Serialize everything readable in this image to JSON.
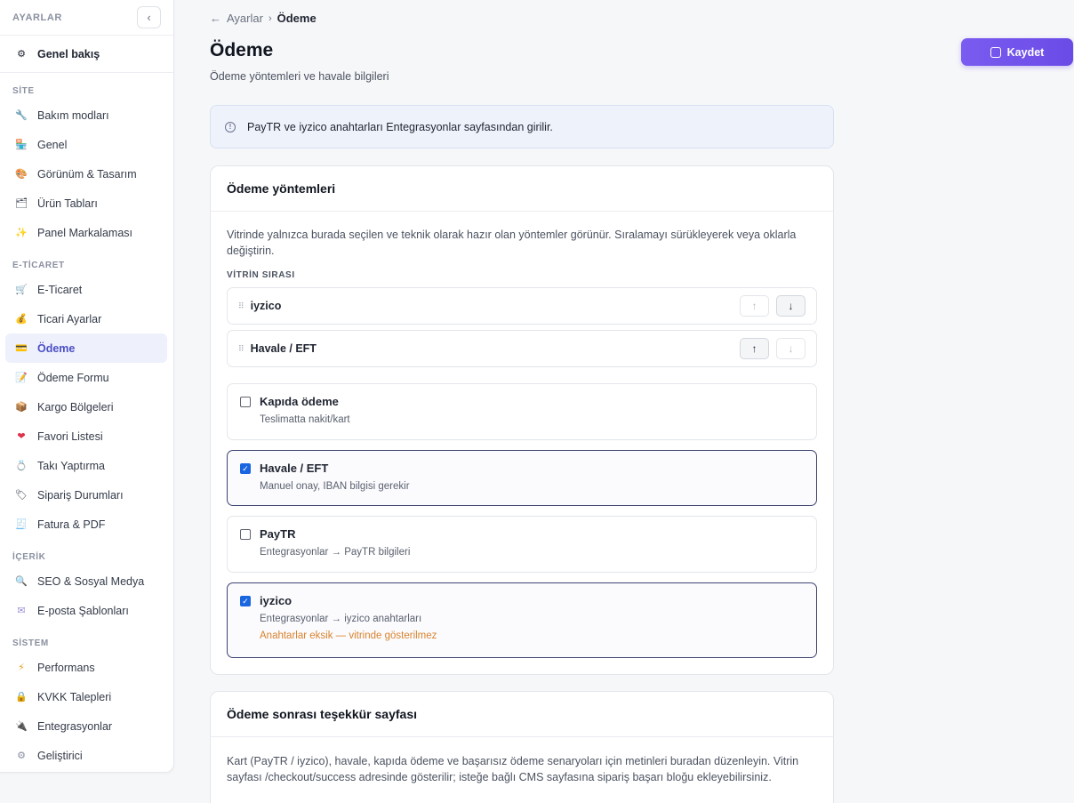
{
  "sidebar": {
    "title": "AYARLAR",
    "collapse_icon": "‹",
    "top_item": {
      "label": "Genel bakış",
      "icon": "⚙"
    },
    "sections": [
      {
        "label": "SİTE",
        "items": [
          {
            "label": "Bakım modları",
            "icon": "🔧"
          },
          {
            "label": "Genel",
            "icon": "🏪"
          },
          {
            "label": "Görünüm & Tasarım",
            "icon": "🎨"
          },
          {
            "label": "Ürün Tabları",
            "icon": "🗂"
          },
          {
            "label": "Panel Markalaması",
            "icon": "✨"
          }
        ]
      },
      {
        "label": "E-TİCARET",
        "items": [
          {
            "label": "E-Ticaret",
            "icon": "🛒"
          },
          {
            "label": "Ticari Ayarlar",
            "icon": "💰"
          },
          {
            "label": "Ödeme",
            "icon": "💳"
          },
          {
            "label": "Ödeme Formu",
            "icon": "📝"
          },
          {
            "label": "Kargo Bölgeleri",
            "icon": "📦"
          },
          {
            "label": "Favori Listesi",
            "icon": "❤"
          },
          {
            "label": "Takı Yaptırma",
            "icon": "💍"
          },
          {
            "label": "Sipariş Durumları",
            "icon": "🏷"
          },
          {
            "label": "Fatura & PDF",
            "icon": "🧾"
          }
        ]
      },
      {
        "label": "İÇERİK",
        "items": [
          {
            "label": "SEO & Sosyal Medya",
            "icon": "🔍"
          },
          {
            "label": "E-posta Şablonları",
            "icon": "✉"
          }
        ]
      },
      {
        "label": "SİSTEM",
        "items": [
          {
            "label": "Performans",
            "icon": "⚡"
          },
          {
            "label": "KVKK Talepleri",
            "icon": "🔒"
          },
          {
            "label": "Entegrasyonlar",
            "icon": "🔌"
          },
          {
            "label": "Geliştirici",
            "icon": "⚙"
          }
        ]
      }
    ]
  },
  "breadcrumb": {
    "back_arrow": "←",
    "parent": "Ayarlar",
    "separator": "›",
    "current": "Ödeme"
  },
  "page": {
    "title": "Ödeme",
    "subtitle": "Ödeme yöntemleri ve havale bilgileri"
  },
  "save_button": {
    "label": "Kaydet"
  },
  "info_banner": {
    "icon": "!",
    "text": "PayTR ve iyzico anahtarları Entegrasyonlar sayfasından girilir."
  },
  "payment_methods_card": {
    "title": "Ödeme yöntemleri",
    "description": "Vitrinde yalnızca burada seçilen ve teknik olarak hazır olan yöntemler görünür. Sıralamayı sürükleyerek veya oklarla değiştirin.",
    "order_label": "VİTRİN SIRASI",
    "order": [
      {
        "name": "iyzico",
        "up_enabled": false,
        "down_enabled": true
      },
      {
        "name": "Havale / EFT",
        "up_enabled": true,
        "down_enabled": false
      }
    ],
    "arrow_up": "↑",
    "arrow_down": "↓",
    "drag_handle": "⠿",
    "methods": [
      {
        "name": "Kapıda ödeme",
        "desc": "Teslimatta nakit/kart",
        "checked": false,
        "warning": ""
      },
      {
        "name": "Havale / EFT",
        "desc": "Manuel onay, IBAN bilgisi gerekir",
        "checked": true,
        "warning": ""
      },
      {
        "name": "PayTR",
        "desc": "Entegrasyonlar → PayTR bilgileri",
        "checked": false,
        "warning": ""
      },
      {
        "name": "iyzico",
        "desc": "Entegrasyonlar → iyzico anahtarları",
        "checked": true,
        "warning": "Anahtarlar eksik — vitrinde gösterilmez"
      }
    ],
    "check_mark": "✓"
  },
  "thanks_card": {
    "title": "Ödeme sonrası teşekkür sayfası",
    "description": "Kart (PayTR / iyzico), havale, kapıda ödeme ve başarısız ödeme senaryoları için metinleri buradan düzenleyin. Vitrin sayfası /checkout/success adresinde gösterilir; isteğe bağlı CMS sayfasına sipariş başarı bloğu ekleyebilirsiniz."
  }
}
